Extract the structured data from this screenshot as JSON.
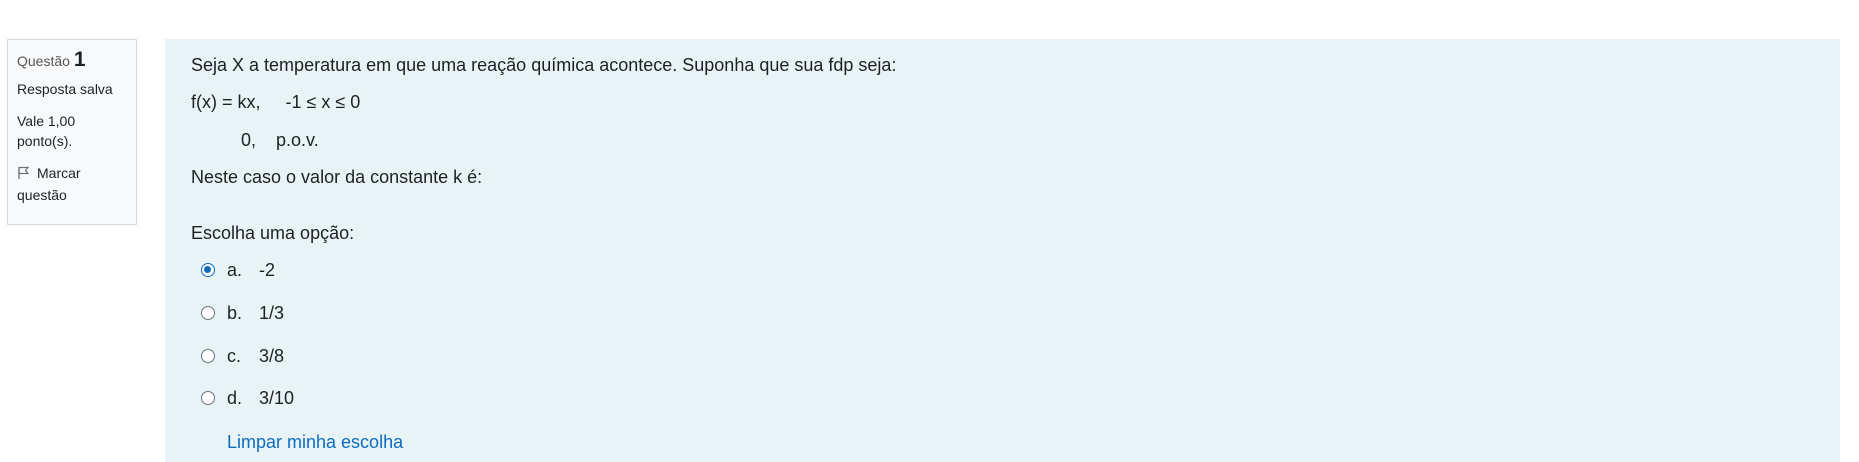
{
  "question_info": {
    "label": "Questão",
    "number": "1",
    "status": "Resposta salva",
    "grade_line1": "Vale 1,00",
    "grade_line2": "ponto(s).",
    "flag_line1": "Marcar",
    "flag_line2": "questão"
  },
  "question": {
    "text": "Seja X a temperatura em que uma reação química acontece. Suponha que sua fdp seja:",
    "formula_line1": "f(x) = kx,     -1 ≤ x ≤ 0",
    "formula_line2": "0,    p.o.v.",
    "prompt": "Neste caso o valor da constante k é:",
    "choose_label": "Escolha uma opção:",
    "options": [
      {
        "letter": "a.",
        "value": "-2",
        "checked": true
      },
      {
        "letter": "b.",
        "value": "1/3",
        "checked": false
      },
      {
        "letter": "c.",
        "value": "3/8",
        "checked": false
      },
      {
        "letter": "d.",
        "value": "3/10",
        "checked": false
      }
    ],
    "clear_label": "Limpar minha escolha"
  },
  "colors": {
    "accent": "#0f6cbf",
    "content_bg": "#e7f3f5",
    "info_bg": "#f8f9fa"
  },
  "icons": {
    "flag": "flag-icon"
  }
}
